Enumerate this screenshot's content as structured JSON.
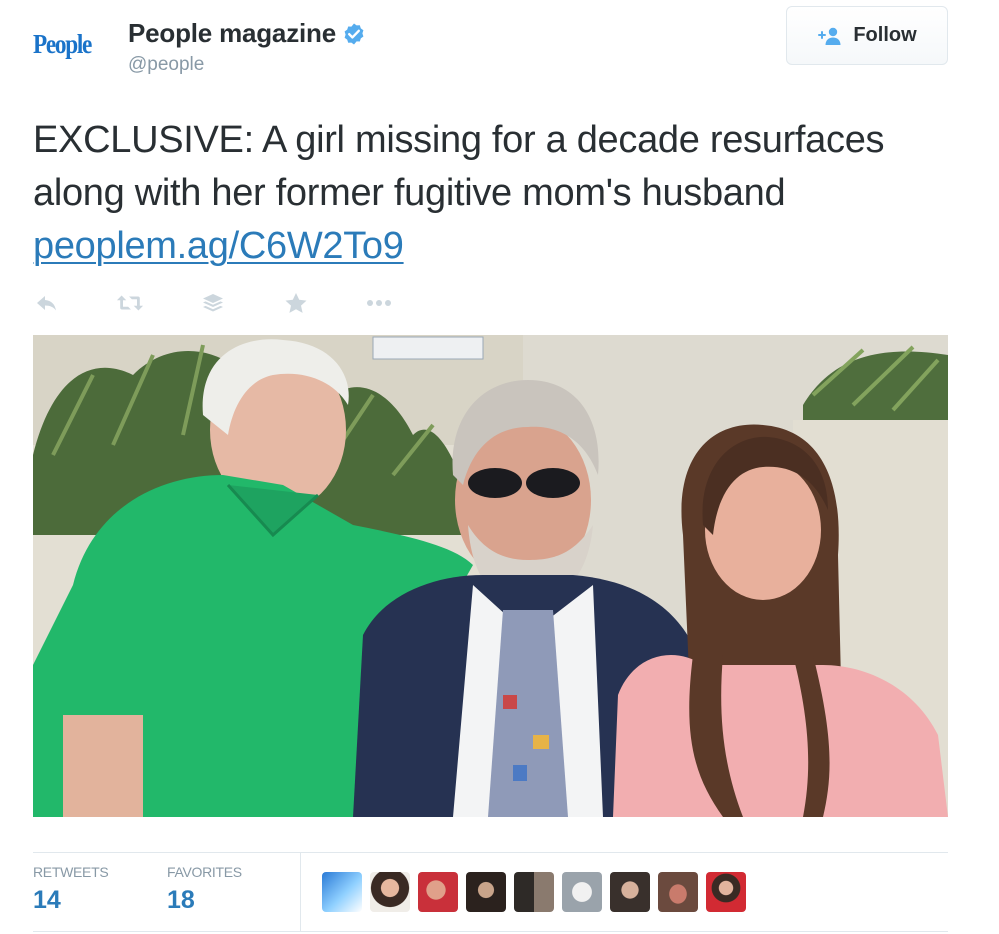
{
  "author": {
    "logo_text": "People",
    "display_name": "People magazine",
    "handle": "@people",
    "verified": true
  },
  "follow": {
    "label": "Follow",
    "icon": "add-user-icon"
  },
  "tweet": {
    "text": "EXCLUSIVE: A girl missing for a decade resurfaces along with her former fugitive mom's husband",
    "link": "peoplem.ag/C6W2To9"
  },
  "actions": [
    {
      "name": "reply",
      "icon": "reply-icon"
    },
    {
      "name": "retweet",
      "icon": "retweet-icon"
    },
    {
      "name": "buffer",
      "icon": "stack-icon"
    },
    {
      "name": "favorite",
      "icon": "star-icon"
    },
    {
      "name": "more",
      "icon": "more-dots-icon"
    }
  ],
  "stats": {
    "retweets_label": "RETWEETS",
    "retweets_count": "14",
    "favorites_label": "FAVORITES",
    "favorites_count": "18"
  },
  "colors": {
    "link": "#2b7bb9",
    "verified": "#55acee",
    "text": "#292f33",
    "muted": "#8899a6",
    "brand": "#1a73c9"
  },
  "favorited_by_count": 9
}
